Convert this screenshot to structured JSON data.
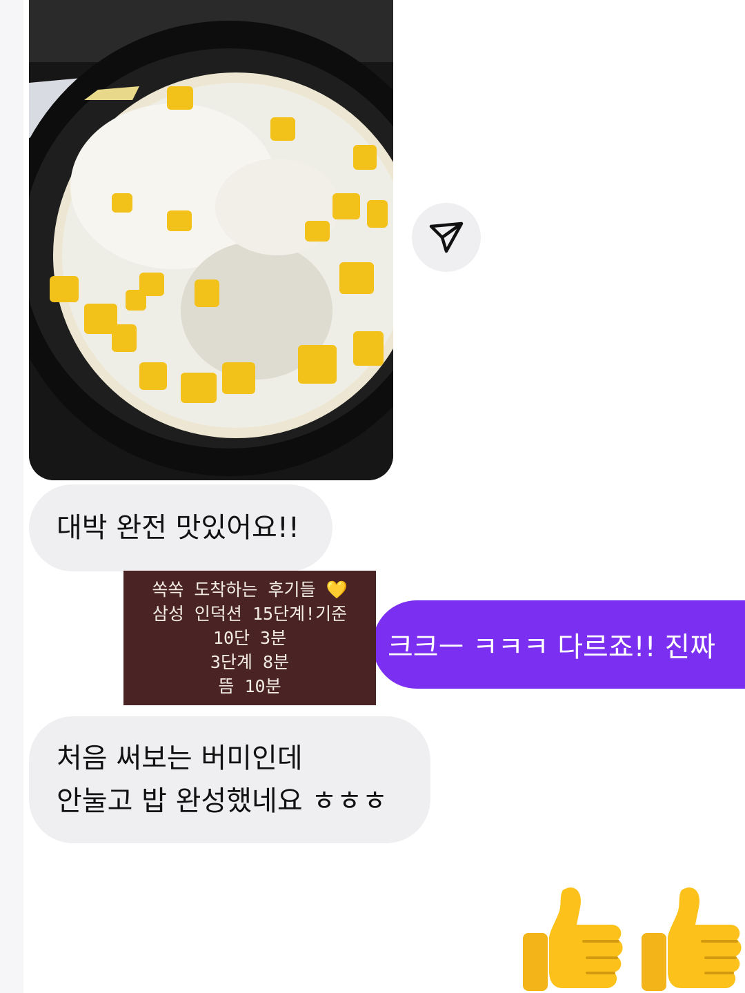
{
  "messages": {
    "received_1": "대박 완전 맛있어요!!",
    "received_2_line1": "처음 써보는 버미인데",
    "received_2_line2": "안눌고 밥 완성했네요 ㅎㅎㅎ",
    "sent_1": "크크ㅡ ㅋㅋㅋ 다르죠!! 진짜"
  },
  "overlay_note": {
    "line1": "쏙쏙 도착하는 후기들",
    "heart": "💛",
    "line2": "삼성 인덕션 15단계!기준",
    "line3": "10단 3분",
    "line4": "3단계 8분",
    "line5": "뜸 10분"
  },
  "icons": {
    "share": "send-icon",
    "thumbs": "thumbs-up-icon"
  },
  "colors": {
    "sent_bubble": "#7b2ff0",
    "received_bubble": "#efeff2",
    "overlay_bg": "#4a2424"
  }
}
